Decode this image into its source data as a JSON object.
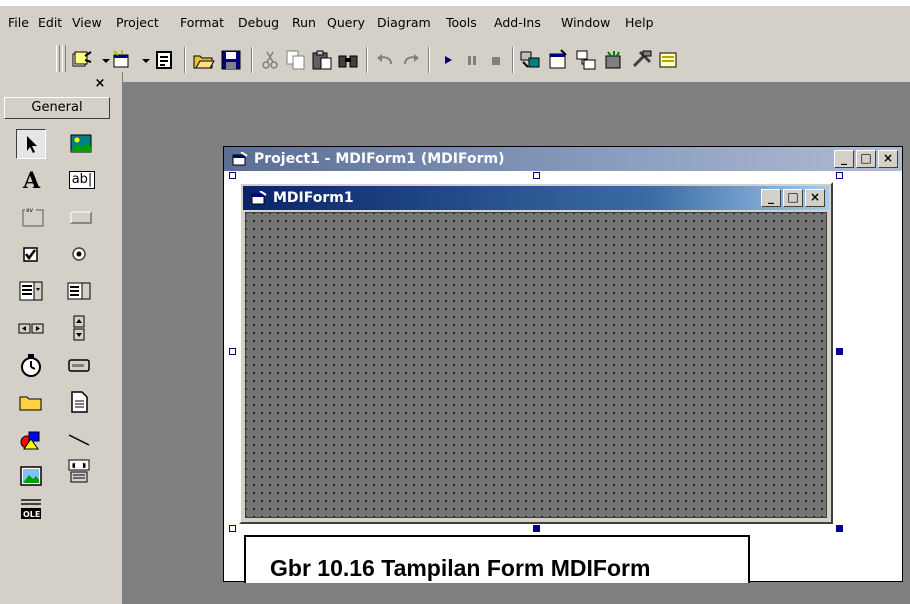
{
  "menu": {
    "items": [
      "File",
      "Edit",
      "View",
      "Project",
      "Format",
      "Debug",
      "Run",
      "Query",
      "Diagram",
      "Tools",
      "Add-Ins",
      "Window",
      "Help"
    ]
  },
  "toolbar": {
    "icons": [
      "add-project-icon",
      "add-form-icon",
      "menu-editor-icon",
      "open-project-icon",
      "save-project-icon",
      "cut-icon",
      "copy-icon",
      "paste-icon",
      "find-icon",
      "undo-icon",
      "redo-icon",
      "start-icon",
      "break-icon",
      "end-icon",
      "project-explorer-icon",
      "properties-window-icon",
      "form-layout-icon",
      "object-browser-icon",
      "toolbox-icon",
      "data-view-icon"
    ]
  },
  "toolbox": {
    "close_glyph": "×",
    "tab_label": "General",
    "textbox_label": "ab|",
    "frame_label": "xv",
    "ole_label": "OLE",
    "tools": [
      "pointer",
      "picturebox",
      "label",
      "textbox",
      "frame",
      "commandbutton",
      "checkbox",
      "optionbutton",
      "combobox",
      "listbox",
      "hscrollbar",
      "vscrollbar",
      "timer",
      "drivelistbox",
      "dirlistbox",
      "filelistbox",
      "shape",
      "line",
      "image",
      "data",
      "ole"
    ]
  },
  "designer_window": {
    "title": "Project1 - MDIForm1 (MDIForm)",
    "buttons": [
      "_",
      "□",
      "×"
    ]
  },
  "mdi_form": {
    "title": "MDIForm1",
    "buttons": [
      "_",
      "□",
      "×"
    ]
  },
  "caption": {
    "text": "Gbr 10.16 Tampilan Form MDIForm"
  },
  "colors": {
    "active_title_start": "#0a246a",
    "active_title_end": "#a6caf0",
    "inactive_title": "#8c9fc0",
    "face": "#d4d0c8",
    "mdi_background": "#808080"
  }
}
